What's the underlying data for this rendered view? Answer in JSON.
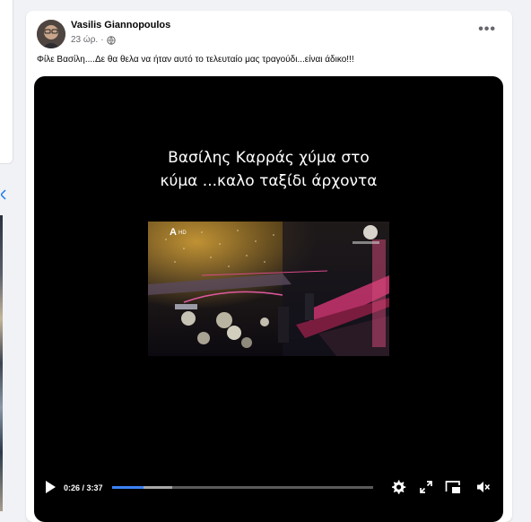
{
  "post": {
    "author": "Vasilis Giannopoulos",
    "time": "23 ώρ.",
    "separator": "·",
    "text": "Φίλε Βασίλη....Δε θα θελα να ήταν αυτό το τελευταίο μας τραγούδι...είναι άδικο!!!",
    "more_label": "•••"
  },
  "video": {
    "caption_line1": "Βασίλης Καρράς χύμα στο",
    "caption_line2": "κύμα ...καλο ταξίδι άρχοντα",
    "channel_logo": "HD",
    "current_time": "0:26",
    "duration": "3:37",
    "time_display": "0:26 / 3:37",
    "progress_fraction": 0.12,
    "buffered_fraction": 0.23
  },
  "icons": {
    "play": "play-icon",
    "settings": "gear-icon",
    "fullscreen": "expand-icon",
    "pip": "picture-in-picture-icon",
    "volume": "speaker-muted-icon",
    "privacy": "globe-icon"
  },
  "colors": {
    "progress_played": "#3b82f6",
    "video_bg": "#000000",
    "card_bg": "#ffffff",
    "page_bg": "#f0f2f5"
  }
}
